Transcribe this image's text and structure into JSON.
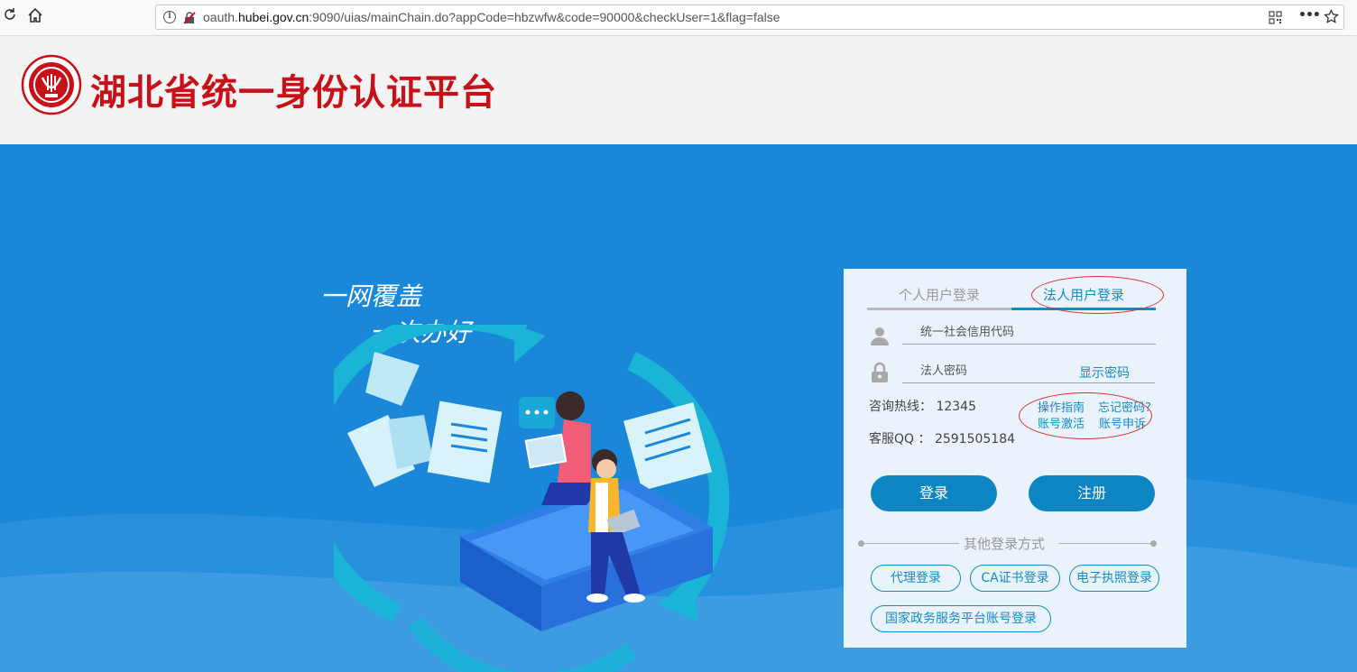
{
  "browser": {
    "url_prefix": "oauth.",
    "url_domain": "hubei.gov.cn",
    "url_rest": ":9090/uias/mainChain.do?appCode=hbzwfw&code=90000&checkUser=1&flag=false",
    "more_label": "•••"
  },
  "header": {
    "title": "湖北省统一身份认证平台"
  },
  "banner": {
    "slogan_line1": "一网覆盖",
    "slogan_line2": "一次办好"
  },
  "login": {
    "tabs": [
      {
        "label": "个人用户登录",
        "active": false
      },
      {
        "label": "法人用户登录",
        "active": true
      }
    ],
    "credit_code_placeholder": "统一社会信用代码",
    "password_placeholder": "法人密码",
    "show_password": "显示密码",
    "hotline": "咨询热线： 12345",
    "qq": "客服QQ ： 2591505184",
    "links": {
      "guide": "操作指南",
      "forgot": "忘记密码?",
      "activate": "账号激活",
      "appeal": "账号申诉"
    },
    "login_button": "登录",
    "register_button": "注册",
    "other_methods": "其他登录方式",
    "alt_logins": [
      "代理登录",
      "CA证书登录",
      "电子执照登录",
      "国家政务服务平台账号登录"
    ]
  },
  "colors": {
    "banner_bg": "#1a87d8",
    "title_red": "#c71017",
    "accent": "#138bc7",
    "button": "#0e85c3",
    "panel_bg": "#eaf3fb"
  },
  "icons": [
    "reload-icon",
    "home-icon",
    "info-icon",
    "insecure-lock-icon",
    "qr-code-icon",
    "bookmark-star-icon",
    "user-icon",
    "lock-icon"
  ]
}
